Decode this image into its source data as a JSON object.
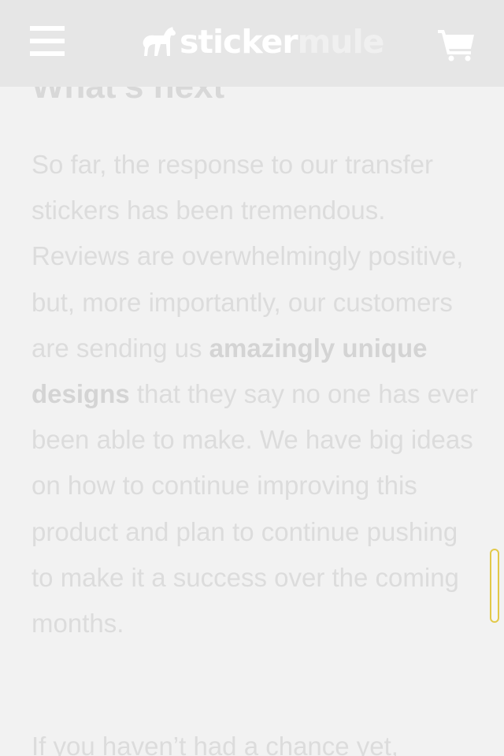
{
  "header": {
    "menu_icon": "hamburger-menu-icon",
    "logo": {
      "mascot_icon": "mule-icon",
      "word_1": "sticker",
      "word_2": "mule"
    },
    "cart_icon": "shopping-cart-icon"
  },
  "article": {
    "heading": "What's next",
    "paragraph_1": {
      "before_bold": "So far, the response to our transfer stickers has been tremendous. Reviews are overwhelmingly positive, but, more importantly, our customers are sending us ",
      "bold": "amazingly unique designs",
      "after_bold": " that they say no one has ever been able to make. We have big ideas on how to continue improving this product and plan to continue pushing to make it a success over the coming months."
    },
    "paragraph_2_start": "If you haven’t had a chance yet,"
  },
  "scrollbar": {
    "icon": "scroll-indicator"
  },
  "colors": {
    "header_bg": "#e6e6e6",
    "page_bg": "#f2f2f2",
    "text": "#dcdcdc",
    "scroll_border": "#e2c94a"
  }
}
